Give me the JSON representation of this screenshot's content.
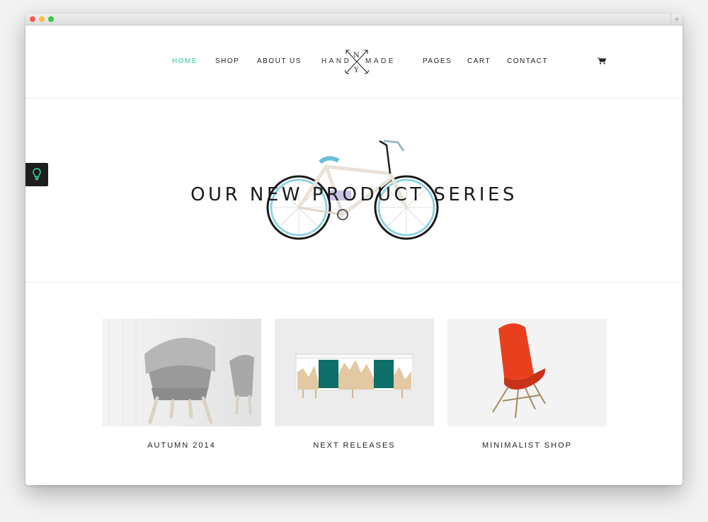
{
  "browser": {
    "new_tab": "+"
  },
  "nav": {
    "home": "HOME",
    "shop": "SHOP",
    "about": "ABOUT US",
    "pages": "PAGES",
    "cart": "CART",
    "contact": "CONTACT"
  },
  "logo": {
    "left": "HAND",
    "right": "MADE",
    "top_letter": "N",
    "bottom_letter": "Y"
  },
  "hero": {
    "title": "OUR NEW PRODUCT SERIES"
  },
  "cards": [
    {
      "label": "AUTUMN 2014"
    },
    {
      "label": "NEXT RELEASES"
    },
    {
      "label": "MINIMALIST SHOP"
    }
  ],
  "colors": {
    "accent": "#31c7a4",
    "chair_red": "#e8401f",
    "teal": "#0d6f68"
  },
  "icons": {
    "cart": "cart-icon",
    "help": "lightbulb-icon"
  }
}
